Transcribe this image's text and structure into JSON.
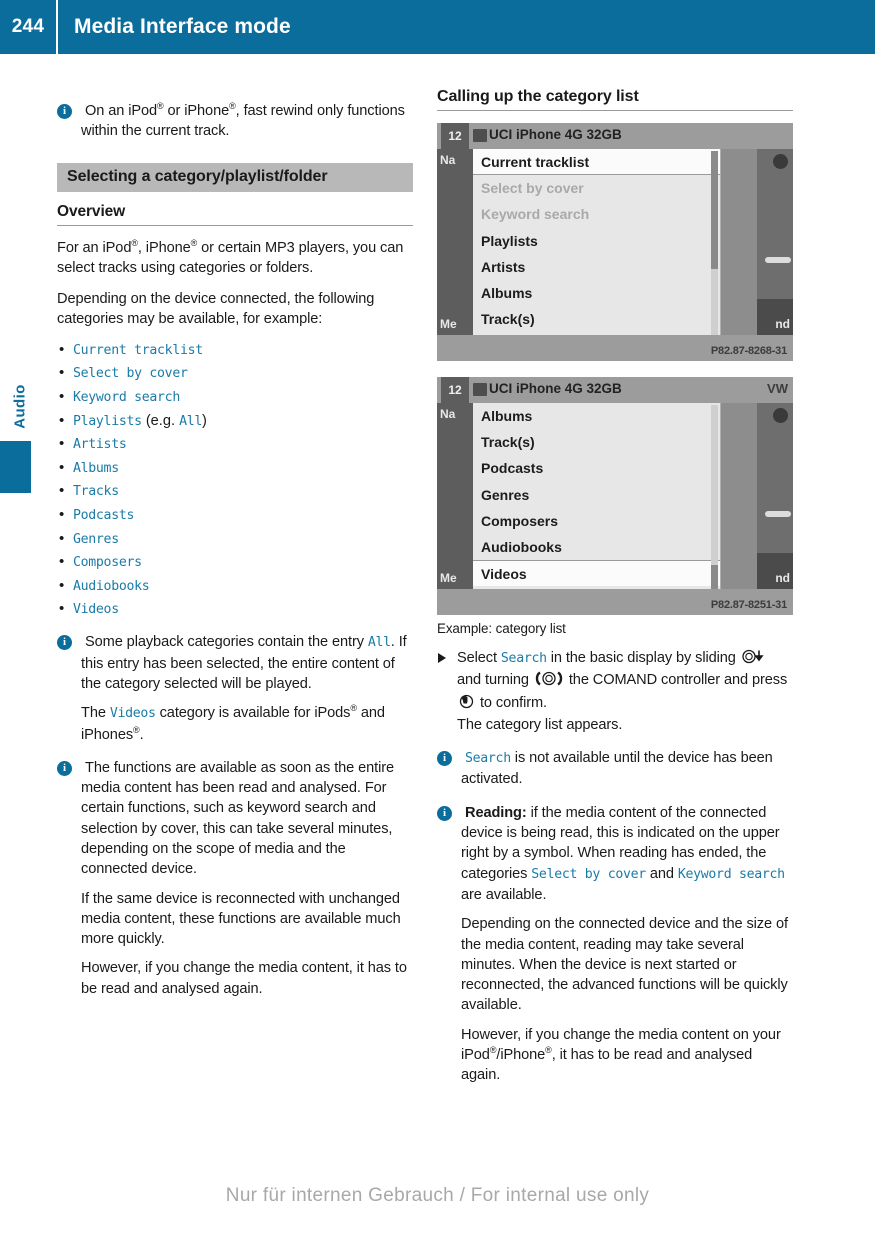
{
  "header": {
    "page_number": "244",
    "title": "Media Interface mode"
  },
  "side_tab": {
    "label": "Audio",
    "accent_color": "#0a6d9c"
  },
  "left_column": {
    "note_rewind": {
      "icon": "info-icon",
      "text_part1": "On an iPod",
      "text_part2": " or iPhone",
      "text_part3": ", fast rewind only functions within the current track."
    },
    "section_banner": "Selecting a category/playlist/folder",
    "sub_heading": "Overview",
    "para_overview_1_a": "For an iPod",
    "para_overview_1_b": ", iPhone",
    "para_overview_1_c": " or certain MP3 players, you can select tracks using categories or folders.",
    "para_overview_2": "Depending on the device connected, the following categories may be available, for example:",
    "categories": [
      {
        "name": "Current tracklist",
        "suffix": ""
      },
      {
        "name": "Select by cover",
        "suffix": ""
      },
      {
        "name": "Keyword search",
        "suffix": ""
      },
      {
        "name": "Playlists",
        "suffix": " (e.g. All)",
        "suffix_plain": " (e.g. ",
        "suffix_mono": "All",
        "suffix_close": ")"
      },
      {
        "name": "Artists",
        "suffix": ""
      },
      {
        "name": "Albums",
        "suffix": ""
      },
      {
        "name": "Tracks",
        "suffix": ""
      },
      {
        "name": "Podcasts",
        "suffix": ""
      },
      {
        "name": "Genres",
        "suffix": ""
      },
      {
        "name": "Composers",
        "suffix": ""
      },
      {
        "name": "Audiobooks",
        "suffix": ""
      },
      {
        "name": "Videos",
        "suffix": ""
      }
    ],
    "note_all": {
      "line1_a": "Some playback categories contain the entry ",
      "line1_mono": "All",
      "line1_b": ". If this entry has been selected, the entire content of the category selected will be played.",
      "line2_a": "The ",
      "line2_mono": "Videos",
      "line2_b": " category is available for iPods",
      "line2_c": " and iPhones",
      "line2_d": "."
    },
    "note_functions": {
      "para1": "The functions are available as soon as the entire media content has been read and analysed. For certain functions, such as keyword search and selection by cover, this can take several minutes, depending on the scope of media and the connected device.",
      "para2": "If the same device is reconnected with unchanged media content, these functions are available much more quickly.",
      "para3": "However, if you change the media content, it has to be read and analysed again."
    }
  },
  "right_column": {
    "heading": "Calling up the category list",
    "figure_1": {
      "clock": "12",
      "device_title": "UCI iPhone 4G 32GB",
      "top_right": "",
      "left_labels": {
        "top": "Na",
        "bottom": "Me"
      },
      "right_label_bottom": "nd",
      "image_code": "P82.87-8268-31",
      "menu_items": [
        {
          "label": "Current tracklist",
          "state": "selected"
        },
        {
          "label": "Select by cover",
          "state": "dimmed"
        },
        {
          "label": "Keyword search",
          "state": "dimmed"
        },
        {
          "label": "Playlists",
          "state": "normal"
        },
        {
          "label": "Artists",
          "state": "normal"
        },
        {
          "label": "Albums",
          "state": "normal"
        },
        {
          "label": "Track(s)",
          "state": "normal"
        }
      ]
    },
    "figure_2": {
      "clock": "12",
      "device_title": "UCI iPhone 4G 32GB",
      "top_right": "VW",
      "left_labels": {
        "top": "Na",
        "bottom": "Me"
      },
      "right_label_bottom": "nd",
      "image_code": "P82.87-8251-31",
      "menu_items": [
        {
          "label": "Albums",
          "state": "normal"
        },
        {
          "label": "Track(s)",
          "state": "normal"
        },
        {
          "label": "Podcasts",
          "state": "normal"
        },
        {
          "label": "Genres",
          "state": "normal"
        },
        {
          "label": "Composers",
          "state": "normal"
        },
        {
          "label": "Audiobooks",
          "state": "normal"
        },
        {
          "label": "Videos",
          "state": "selected-bottom"
        }
      ]
    },
    "figure_caption": "Example: category list",
    "step_select": {
      "a": "Select ",
      "mono_search": "Search",
      "b": " in the basic display by sliding ",
      "icon_slide": "controller-slide-down-icon",
      "c": " and turning ",
      "icon_turn": "controller-turn-icon",
      "d": " the COMAND controller and press ",
      "icon_press": "controller-press-icon",
      "e": " to confirm.",
      "result": "The category list appears."
    },
    "note_search": {
      "mono": "Search",
      "text": " is not available until the device has been activated."
    },
    "note_reading": {
      "bold": "Reading:",
      "text_a": " if the media content of the connected device is being read, this is indicated on the upper right by a symbol. When reading has ended, the categories ",
      "mono_1": "Select by cover",
      "text_b": " and ",
      "mono_2": "Keyword search",
      "text_c": " are available.",
      "para2": "Depending on the connected device and the size of the media content, reading may take several minutes. When the device is next started or reconnected, the advanced functions will be quickly available.",
      "para3_a": "However, if you change the media content on your iPod",
      "para3_b": "/iPhone",
      "para3_c": ", it has to be read and analysed again."
    }
  },
  "footer": {
    "watermark": "Nur für internen Gebrauch / For internal use only"
  }
}
